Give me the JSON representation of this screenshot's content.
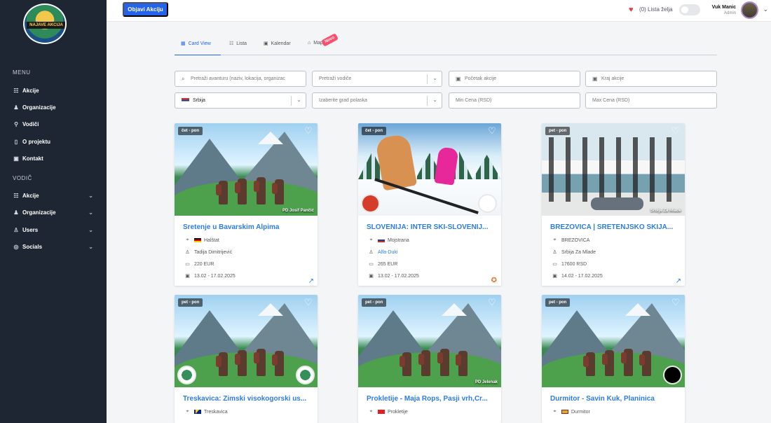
{
  "sidebar": {
    "logo_text": "NAJAVE AKCIJA",
    "menu_title": "MENU",
    "menu_items": [
      {
        "label": "Akcije",
        "icon": "list-icon"
      },
      {
        "label": "Organizacije",
        "icon": "group-icon"
      },
      {
        "label": "Vodiči",
        "icon": "hiker-icon"
      },
      {
        "label": "O projektu",
        "icon": "document-icon"
      },
      {
        "label": "Kontakt",
        "icon": "contact-icon"
      }
    ],
    "guide_title": "VODIČ",
    "guide_items": [
      {
        "label": "Akcije",
        "icon": "list-icon"
      },
      {
        "label": "Organizacije",
        "icon": "group-icon"
      },
      {
        "label": "Users",
        "icon": "users-icon"
      },
      {
        "label": "Socials",
        "icon": "social-icon"
      }
    ]
  },
  "topbar": {
    "post_button": "Objavi Akciju",
    "wishlist": "(0) Lista želja",
    "user_name": "Vuk Manic",
    "user_role": "Admin"
  },
  "tabs": [
    {
      "label": "Card View",
      "icon": "grid-icon"
    },
    {
      "label": "Lista",
      "icon": "list-icon"
    },
    {
      "label": "Kalendar",
      "icon": "calendar-icon"
    },
    {
      "label": "Map",
      "icon": "map-icon"
    }
  ],
  "new_badge": "Novo",
  "filters": {
    "search_placeholder": "Pretraži avanturu (naziv, lokacija, organizac",
    "guide_placeholder": "Pretraži vodiče",
    "start_placeholder": "Početak akcije",
    "end_placeholder": "Kraj akcije",
    "country_value": "Srbija",
    "departure_placeholder": "Izaberite grad polaska",
    "min_price_placeholder": "Min Cena (RSD)",
    "max_price_placeholder": "Max Cena (RSD)"
  },
  "cards": [
    {
      "badge": "čet - pon",
      "org_overlay": "PD Josif Pančić",
      "title": "Sretenje u Bavarskim Alpima",
      "location": "Halštat",
      "organizer": "Tadija Dimitrijević",
      "price": "220 EUR",
      "dates": "13.02 - 17.02.2025"
    },
    {
      "badge": "čet - pon",
      "org_overlay": "",
      "title": "SLOVENIJA: INTER SKI-SLOVENIJ...",
      "location": "Mojstrana",
      "organizer": "Alfa-Duki",
      "price": "265 EUR",
      "dates": "13.02 - 17.02.2025"
    },
    {
      "badge": "pet - pon",
      "org_overlay": "Srbija Za Mlade",
      "title": "BREZOVICA | SRETENJSKO SKIJA...",
      "location": "BREZOVICA",
      "organizer": "Srbija Za Mlade",
      "price": "17600 RSD",
      "dates": "14.02 - 17.02.2025"
    },
    {
      "badge": "pet - pon",
      "org_overlay": "",
      "title": "Treskavica: Zimski visokogorski us...",
      "location": "Treskavica",
      "organizer": "",
      "price": "",
      "dates": ""
    },
    {
      "badge": "pet - pon",
      "org_overlay": "PD Jelenak",
      "title": "Prokletije - Maja Rops, Pasji vrh,Cr...",
      "location": "Prokletije",
      "organizer": "",
      "price": "",
      "dates": ""
    },
    {
      "badge": "pet - pon",
      "org_overlay": "",
      "title": "Durmitor - Savin Kuk, Planinica",
      "location": "Durmitor",
      "organizer": "",
      "price": "",
      "dates": ""
    }
  ]
}
